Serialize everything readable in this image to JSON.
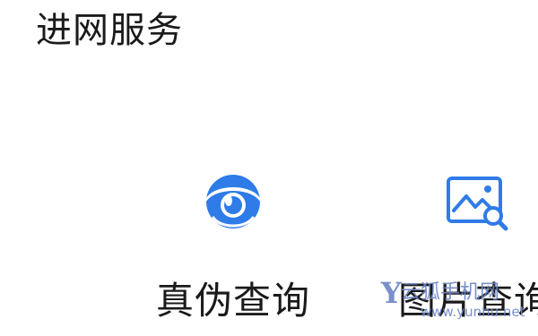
{
  "section": {
    "title": "进网服务"
  },
  "services": [
    {
      "label": "真伪查询",
      "icon": "eye-shield-icon"
    },
    {
      "label": "图片查询",
      "icon": "image-search-icon"
    }
  ],
  "watermark": {
    "logo": "Y",
    "name": "云狐手机网",
    "url": "www.yunhu.net"
  },
  "colors": {
    "accent": "#2f7be8",
    "text": "#1a1a1a",
    "background": "#ffffff",
    "watermark": "#6f86c7"
  }
}
